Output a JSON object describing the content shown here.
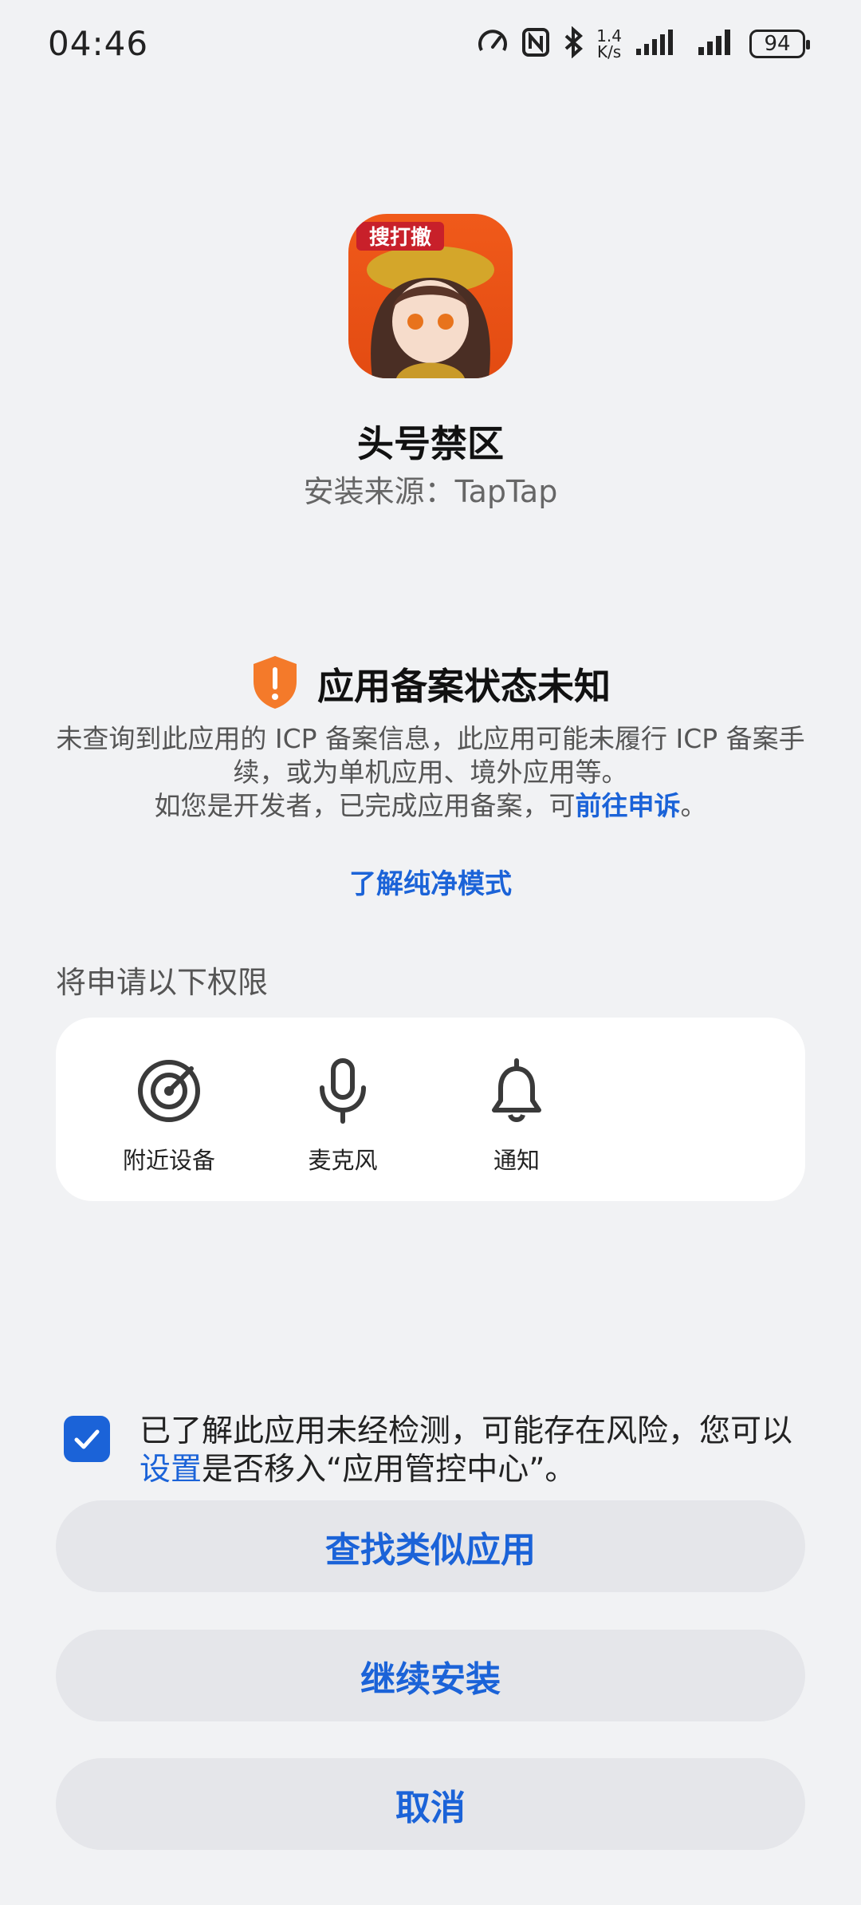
{
  "status_bar": {
    "time": "04:46",
    "net_speed_value": "1.4",
    "net_speed_unit": "K/s",
    "battery": "94"
  },
  "app": {
    "icon_badge": "搜打撤",
    "name": "头号禁区",
    "install_source": "安装来源：TapTap"
  },
  "warning": {
    "title": "应用备案状态未知",
    "desc_line1": "未查询到此应用的 ICP 备案信息，此应用可能未履行 ICP 备案手续，或为单机应用、境外应用等。",
    "desc_line2_prefix": "如您是开发者，已完成应用备案，可",
    "appeal_link": "前往申诉",
    "desc_line2_suffix": "。",
    "learn_more": "了解纯净模式",
    "accent_color": "#f47a2a"
  },
  "permissions": {
    "heading": "将申请以下权限",
    "items": [
      {
        "label": "附近设备",
        "icon": "nearby-devices-icon"
      },
      {
        "label": "麦克风",
        "icon": "microphone-icon"
      },
      {
        "label": "通知",
        "icon": "bell-icon"
      }
    ]
  },
  "acknowledge": {
    "checked": true,
    "text_prefix": "已了解此应用未经检测，可能存在风险，您可以",
    "settings_link": "设置",
    "text_suffix": "是否移入“应用管控中心”。"
  },
  "buttons": {
    "find_similar": "查找类似应用",
    "continue_install": "继续安装",
    "cancel": "取消"
  },
  "colors": {
    "link": "#1b63d8",
    "background": "#f1f2f4",
    "button_bg": "#e5e6ea"
  }
}
